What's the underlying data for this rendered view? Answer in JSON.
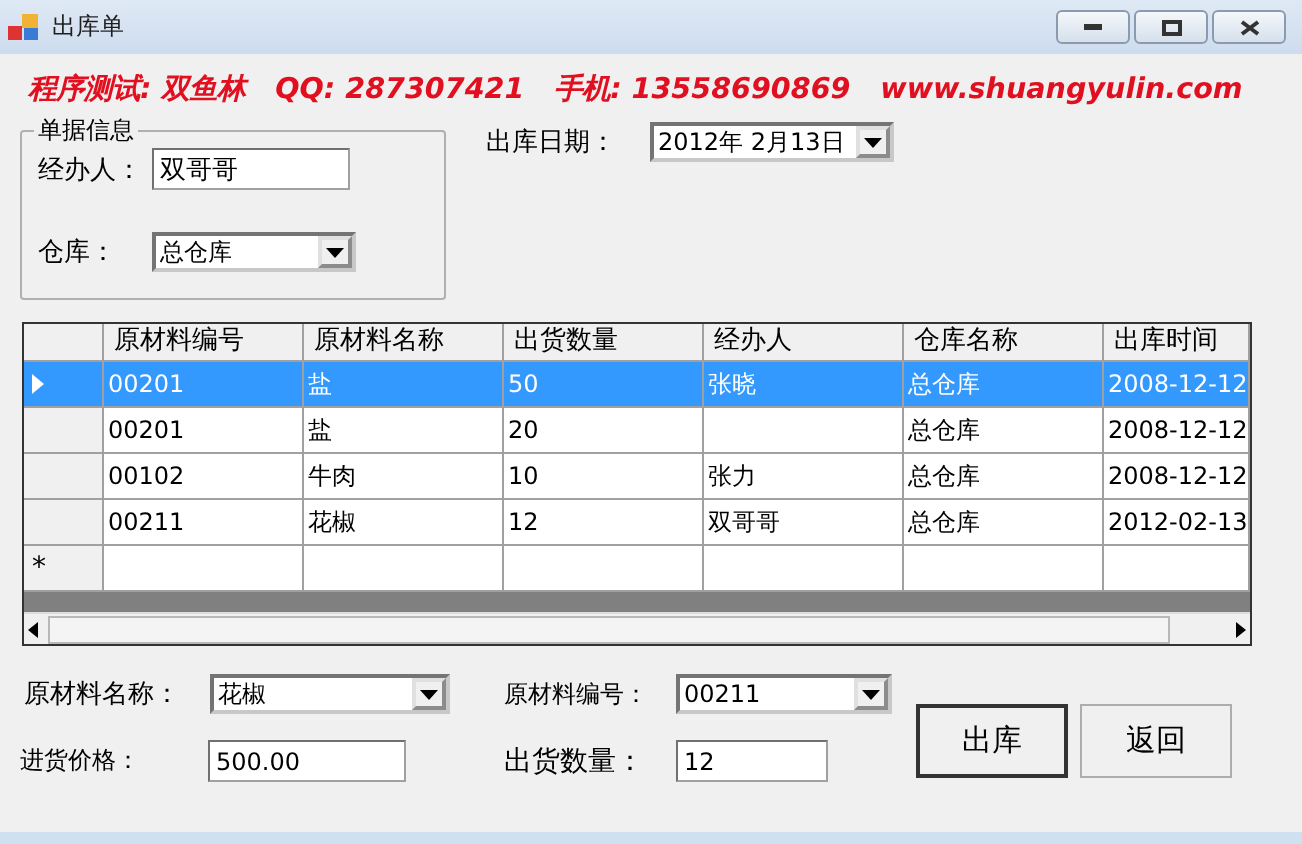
{
  "window": {
    "title": "出库单"
  },
  "banner": "程序测试: 双鱼林   QQ: 287307421   手机: 13558690869   www.shuangyulin.com",
  "group": {
    "title": "单据信息",
    "handler": {
      "label": "经办人：",
      "value": "双哥哥"
    },
    "warehouse": {
      "label": "仓库：",
      "value": "总仓库"
    }
  },
  "date": {
    "label": "出库日期：",
    "value": "2012年  2月13日"
  },
  "table": {
    "columns": [
      "原材料编号",
      "原材料名称",
      "出货数量",
      "经办人",
      "仓库名称",
      "出库时间"
    ],
    "rows": [
      {
        "selected": true,
        "cells": [
          "00201",
          "盐",
          "50",
          "张晓",
          "总仓库",
          "2008-12-12"
        ]
      },
      {
        "selected": false,
        "cells": [
          "00201",
          "盐",
          "20",
          "",
          "总仓库",
          "2008-12-12"
        ]
      },
      {
        "selected": false,
        "cells": [
          "00102",
          "牛肉",
          "10",
          "张力",
          "总仓库",
          "2008-12-12"
        ]
      },
      {
        "selected": false,
        "cells": [
          "00211",
          "花椒",
          "12",
          "双哥哥",
          "总仓库",
          "2012-02-13"
        ]
      }
    ],
    "new_row_marker": "*"
  },
  "form": {
    "material_name": {
      "label": "原材料名称：",
      "value": "花椒"
    },
    "material_code": {
      "label": "原材料编号：",
      "value": "00211"
    },
    "price": {
      "label": "进货价格：",
      "value": "500.00"
    },
    "quantity": {
      "label": "出货数量：",
      "value": "12"
    }
  },
  "buttons": [
    "出库",
    "返回"
  ]
}
